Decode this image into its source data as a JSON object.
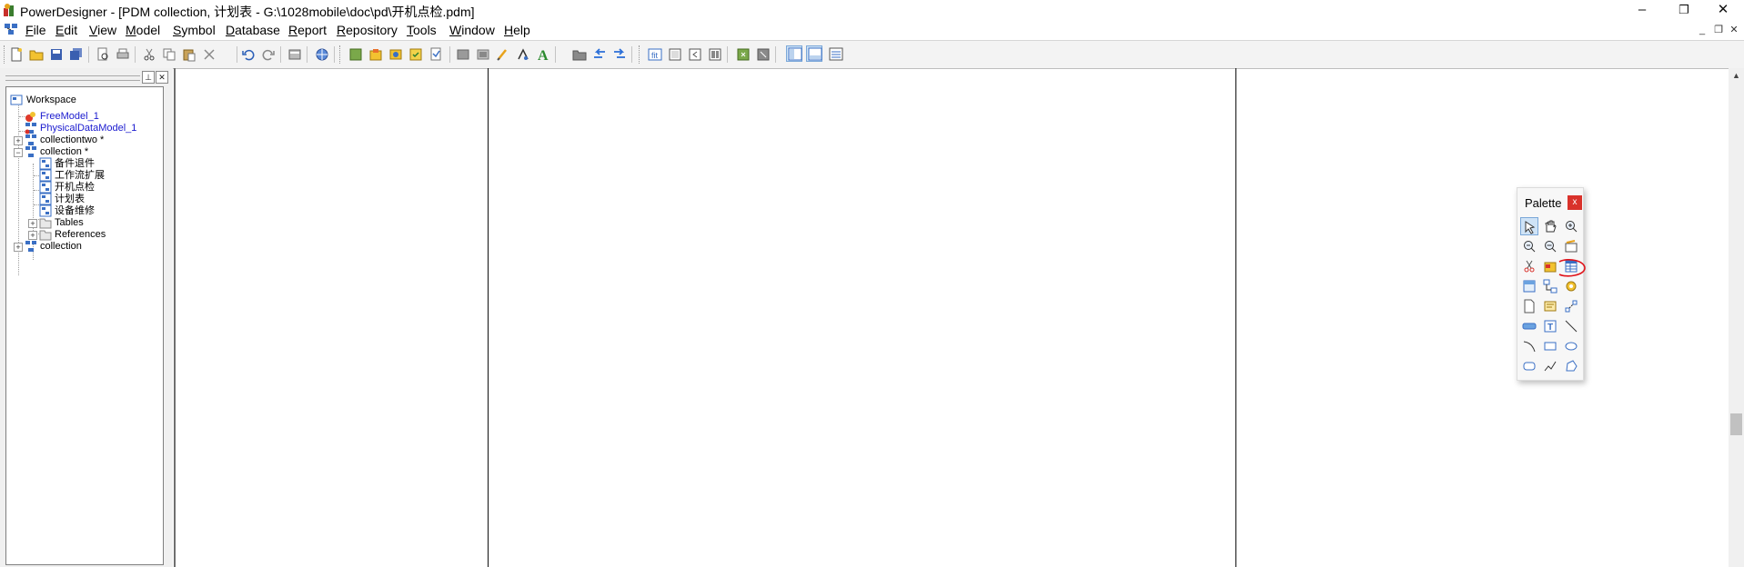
{
  "window": {
    "title": "PowerDesigner - [PDM collection, 计划表 - G:\\1028mobile\\doc\\pd\\开机点检.pdm]",
    "minimize": "–",
    "restore": "❐",
    "close": "✕"
  },
  "menu": {
    "items": [
      {
        "u": "F",
        "rest": "ile"
      },
      {
        "u": "E",
        "rest": "dit"
      },
      {
        "u": "V",
        "rest": "iew"
      },
      {
        "u": "M",
        "rest": "odel"
      },
      {
        "u": "S",
        "rest": "ymbol"
      },
      {
        "u": "D",
        "rest": "atabase"
      },
      {
        "u": "R",
        "rest": "eport"
      },
      {
        "u": "R",
        "rest": "epository"
      },
      {
        "u": "T",
        "rest": "ools"
      },
      {
        "u": "W",
        "rest": "indow"
      },
      {
        "u": "H",
        "rest": "elp"
      }
    ],
    "mdi_minimize": "_",
    "mdi_restore": "❐",
    "mdi_close": "✕"
  },
  "toolbar": {
    "icons": [
      "new-icon",
      "open-icon",
      "save-icon",
      "save-all-icon",
      "print-preview-icon",
      "print-icon",
      "cut-icon",
      "copy-icon",
      "paste-icon",
      "delete-icon",
      "undo-icon",
      "redo-icon",
      "properties-icon",
      "web-icon",
      "model-icon",
      "package-icon",
      "diagram-icon",
      "check-model-icon",
      "generate-icon",
      "check-icon",
      "group-icon",
      "ungroup-icon",
      "format-brush-icon",
      "font-icon",
      "text-color-icon",
      "folder-icon",
      "compare-left-icon",
      "compare-right-icon",
      "zoom-fit-icon",
      "page-icon",
      "page-left-icon",
      "page-right-icon",
      "grid-icon",
      "stop-icon",
      "browser-toggle-icon",
      "output-toggle-icon",
      "result-list-icon"
    ]
  },
  "browser": {
    "panel_grip": "",
    "pin_label": "⊥",
    "close_label": "✕",
    "tree": [
      {
        "label": "Workspace",
        "color": "black"
      },
      {
        "label": "FreeModel_1",
        "color": "blue"
      },
      {
        "label": "PhysicalDataModel_1",
        "color": "blue"
      },
      {
        "label": "collectiontwo *",
        "color": "black",
        "expander": "+"
      },
      {
        "label": "collection *",
        "color": "black",
        "expander": "−"
      },
      {
        "label": "备件退件",
        "color": "black"
      },
      {
        "label": "工作流扩展",
        "color": "black"
      },
      {
        "label": "开机点检",
        "color": "black"
      },
      {
        "label": "计划表",
        "color": "black"
      },
      {
        "label": "设备维修",
        "color": "black"
      },
      {
        "label": "Tables",
        "color": "black",
        "expander": "+"
      },
      {
        "label": "References",
        "color": "black",
        "expander": "+"
      },
      {
        "label": "collection",
        "color": "black",
        "expander": "+"
      }
    ]
  },
  "palette": {
    "title": "Palette",
    "close": "x",
    "tools": [
      "pointer-icon",
      "grabber-icon",
      "zoom-in-icon",
      "zoom-out-icon",
      "zoom-out-alt-icon",
      "properties-icon",
      "delete-icon",
      "package-icon",
      "table-icon",
      "view-icon",
      "reference-icon",
      "procedure-icon",
      "file-icon",
      "note-icon",
      "link-icon",
      "title-icon",
      "text-icon",
      "line-icon",
      "arc-icon",
      "rectangle-icon",
      "ellipse-icon",
      "rounded-rectangle-icon",
      "polyline-icon",
      "polygon-icon"
    ]
  },
  "colors": {
    "annotation": "#e0131a",
    "tree_blue": "#1a1acf",
    "palette_close": "#d9322b"
  }
}
